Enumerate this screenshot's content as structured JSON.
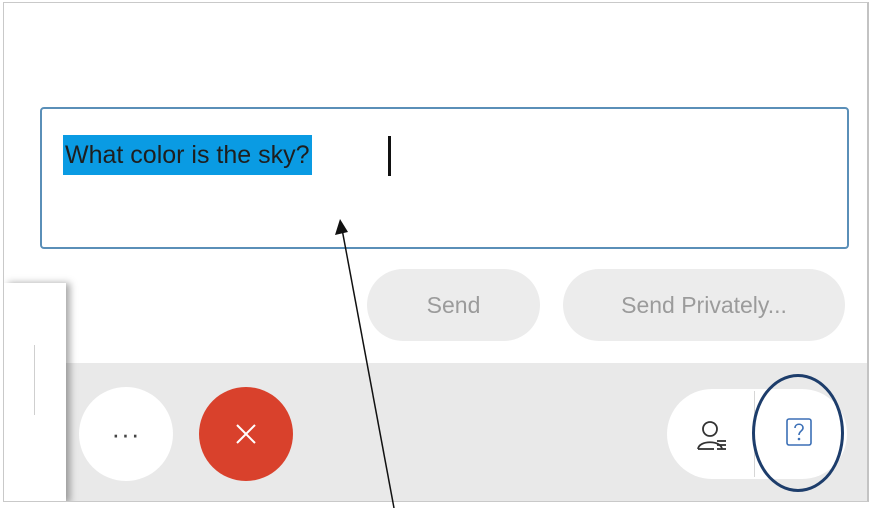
{
  "question": {
    "text": "What color is the sky?"
  },
  "actions": {
    "send_label": "Send",
    "send_privately_label": "Send Privately..."
  },
  "toolbar": {
    "more_label": "···",
    "end_icon": "close-icon",
    "participants_icon": "participants-icon",
    "qa_icon": "question-mark-icon"
  },
  "colors": {
    "selection": "#0a9be3",
    "end_button": "#d9412c",
    "input_border": "#5a8fb8",
    "highlight_circle": "#1d3d6b"
  }
}
